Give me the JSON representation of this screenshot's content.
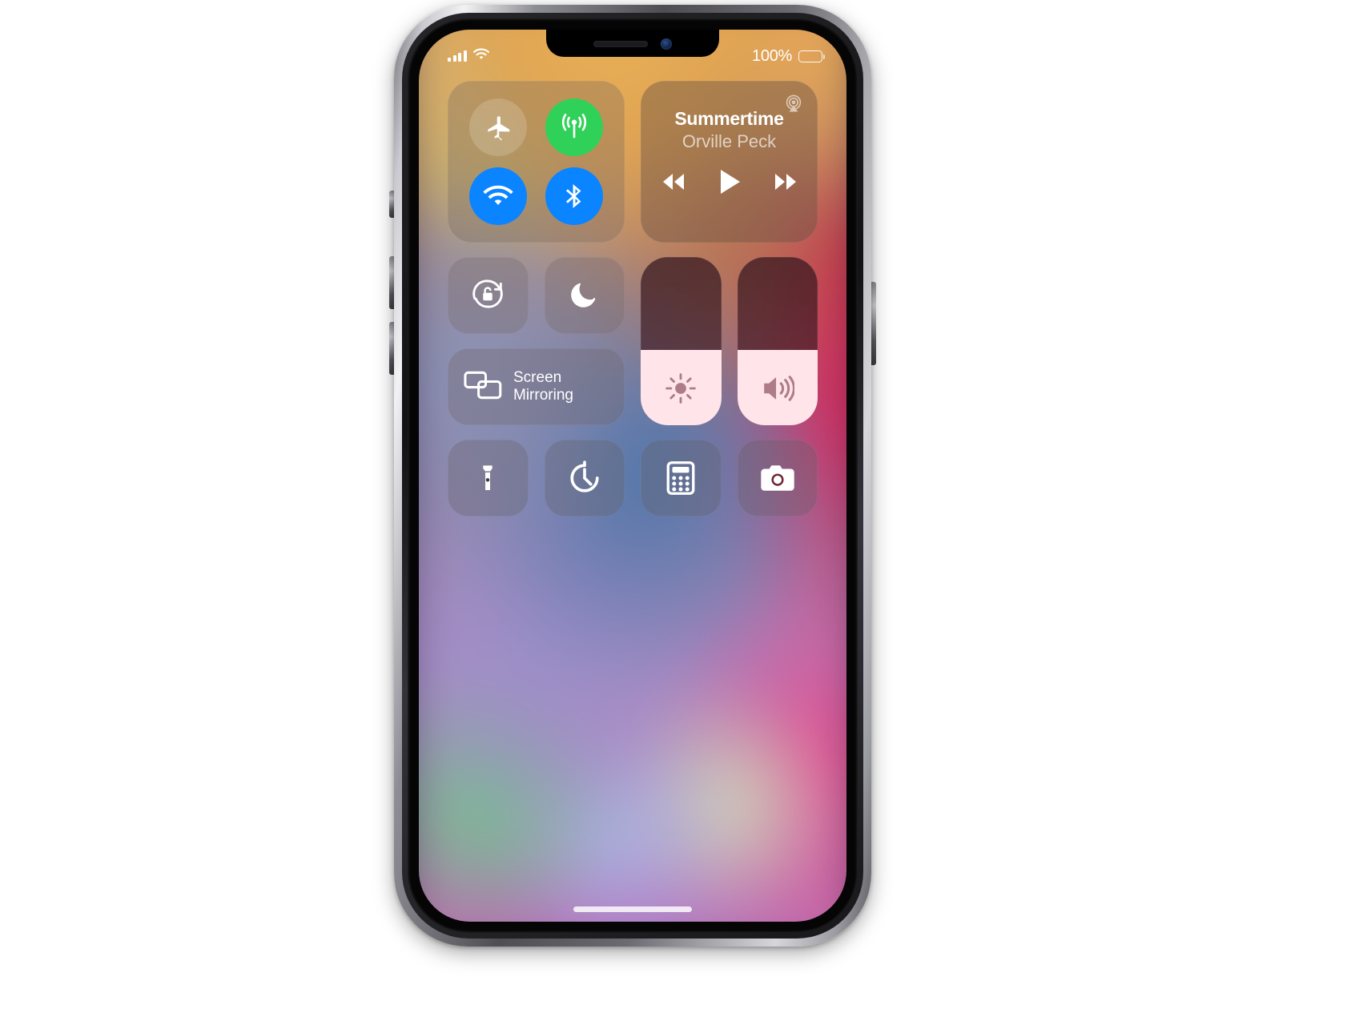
{
  "device": {
    "name": "iPhone",
    "notch": {
      "speaker_icon": "speaker-grille",
      "camera_icon": "front-camera-icon"
    },
    "home_indicator": "home-indicator",
    "side_buttons": [
      "mute-switch",
      "volume-up-button",
      "volume-down-button",
      "side-power-button"
    ]
  },
  "status_bar": {
    "cellular_icon": "signal-bars-icon",
    "signal_bars": 4,
    "wifi_icon": "wifi-icon",
    "battery_percent": "100%",
    "battery_level": 100,
    "battery_icon": "battery-full-icon"
  },
  "control_center": {
    "connectivity": {
      "module_name": "connectivity-module",
      "toggles": [
        {
          "name": "airplane-mode",
          "icon": "airplane-icon",
          "state": "off",
          "color": "rgba(255,255,255,0.17)"
        },
        {
          "name": "cellular-data",
          "icon": "cellular-antenna-icon",
          "state": "on",
          "color": "#30d158"
        },
        {
          "name": "wifi",
          "icon": "wifi-icon",
          "state": "on",
          "color": "#0a84ff"
        },
        {
          "name": "bluetooth",
          "icon": "bluetooth-icon",
          "state": "on",
          "color": "#0a84ff"
        }
      ]
    },
    "now_playing": {
      "module_name": "now-playing-module",
      "title": "Summertime",
      "artist": "Orville Peck",
      "airplay_icon": "airplay-audio-icon",
      "controls": [
        {
          "name": "rewind-button",
          "icon": "rewind-icon"
        },
        {
          "name": "play-button",
          "icon": "play-icon"
        },
        {
          "name": "fast-forward-button",
          "icon": "fast-forward-icon"
        }
      ],
      "playback_state": "paused"
    },
    "mini_toggles": [
      {
        "name": "rotation-lock",
        "icon": "rotation-lock-icon",
        "state": "off"
      },
      {
        "name": "do-not-disturb",
        "icon": "moon-icon",
        "state": "off"
      }
    ],
    "screen_mirroring": {
      "name": "screen-mirroring-tile",
      "label": "Screen\nMirroring",
      "label_line1": "Screen",
      "label_line2": "Mirroring",
      "icon": "screen-mirroring-icon"
    },
    "sliders": [
      {
        "name": "brightness-slider",
        "icon": "brightness-sun-icon",
        "value": 45,
        "fill_color": "#ffe4ea"
      },
      {
        "name": "volume-slider",
        "icon": "speaker-waves-icon",
        "value": 45,
        "fill_color": "#ffe4ea"
      }
    ],
    "utilities": [
      {
        "name": "flashlight-button",
        "icon": "flashlight-icon",
        "state": "off"
      },
      {
        "name": "timer-button",
        "icon": "timer-icon",
        "state": "off"
      },
      {
        "name": "calculator-button",
        "icon": "calculator-icon",
        "state": "off"
      },
      {
        "name": "camera-button",
        "icon": "camera-icon",
        "state": "off"
      }
    ]
  }
}
